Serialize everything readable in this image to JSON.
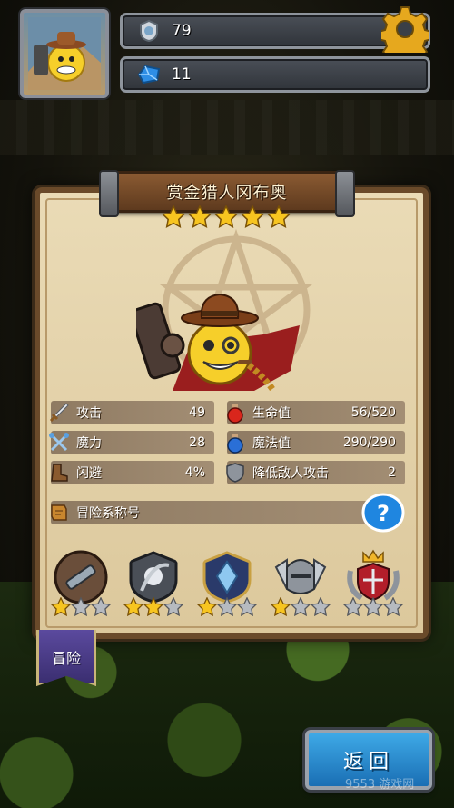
{
  "hud": {
    "trophy_value": "79",
    "gem_value": "11"
  },
  "hero": {
    "name": "赏金猎人冈布奥",
    "stars": 5
  },
  "stats": {
    "attack": {
      "label": "攻击",
      "value": "49"
    },
    "magic": {
      "label": "魔力",
      "value": "28"
    },
    "dodge": {
      "label": "闪避",
      "value": "4%"
    },
    "hp": {
      "label": "生命值",
      "value": "56/520"
    },
    "mp": {
      "label": "魔法值",
      "value": "290/290"
    },
    "damage_reduce": {
      "label": "降低敌人攻击",
      "value": "2"
    }
  },
  "adventure_title": {
    "label": "冒险系称号"
  },
  "badges": [
    {
      "icon": "spyglass-badge-icon",
      "stars": 1
    },
    {
      "icon": "reaper-badge-icon",
      "stars": 2
    },
    {
      "icon": "crystal-badge-icon",
      "stars": 1
    },
    {
      "icon": "knight-helmet-badge-icon",
      "stars": 1
    },
    {
      "icon": "crowned-shield-badge-icon",
      "stars": 0
    }
  ],
  "tab": {
    "label": "冒险"
  },
  "back_button": {
    "label": "返回"
  },
  "watermark": "9553 游戏网",
  "colors": {
    "parchment": "#e5d5ad",
    "wood": "#6a4a2a",
    "back_blue": "#2a8cd0",
    "tab_purple": "#4a3c88",
    "star_gold": "#f7c520"
  }
}
